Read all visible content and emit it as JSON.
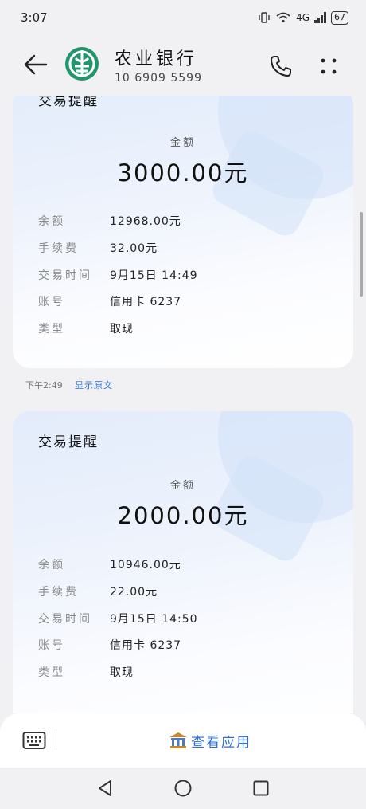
{
  "status": {
    "time": "3:07",
    "network": "4G",
    "battery": "67"
  },
  "header": {
    "title": "农业银行",
    "number": "10 6909 5599",
    "back_icon": "arrow-left-icon",
    "call_icon": "phone-icon",
    "more_icon": "more-dots-icon"
  },
  "messages": [
    {
      "title": "交易提醒",
      "amount_label": "金额",
      "amount": "3000.00元",
      "rows": [
        {
          "label": "余额",
          "value": "12968.00元"
        },
        {
          "label": "手续费",
          "value": "32.00元"
        },
        {
          "label": "交易时间",
          "value": "9月15日 14:49"
        },
        {
          "label": "账号",
          "value": "信用卡 6237"
        },
        {
          "label": "类型",
          "value": "取现"
        }
      ],
      "time": "下午2:49",
      "show_original": "显示原文"
    },
    {
      "title": "交易提醒",
      "amount_label": "金额",
      "amount": "2000.00元",
      "rows": [
        {
          "label": "余额",
          "value": "10946.00元"
        },
        {
          "label": "手续费",
          "value": "22.00元"
        },
        {
          "label": "交易时间",
          "value": "9月15日 14:50"
        },
        {
          "label": "账号",
          "value": "信用卡 6237"
        },
        {
          "label": "类型",
          "value": "取现"
        }
      ]
    }
  ],
  "bottom_bar": {
    "keyboard_icon": "keyboard-icon",
    "view_app_label": "查看应用",
    "view_app_icon": "bank-building-icon"
  },
  "nav": {
    "back": "triangle-back-icon",
    "home": "circle-home-icon",
    "recent": "square-recent-icon"
  },
  "colors": {
    "brand_green": "#23956d",
    "link_blue": "#2f6fd6",
    "background": "#f1f1f4"
  }
}
